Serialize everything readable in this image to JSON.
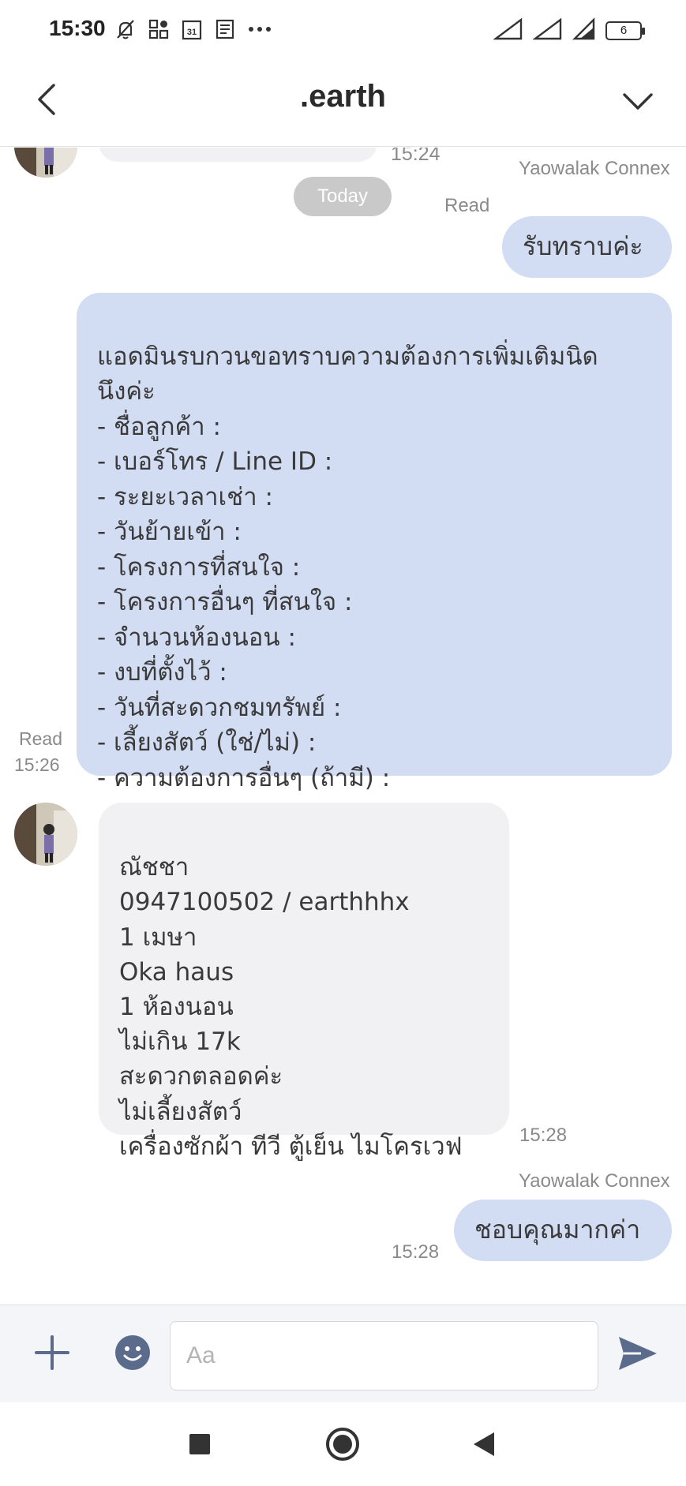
{
  "status_bar": {
    "time": "15:30",
    "icons": [
      "mute-bell-icon",
      "apps-icon",
      "calendar-31-icon",
      "news-icon",
      "more-dots-icon"
    ],
    "battery_level": "6"
  },
  "header": {
    "title": ".earth",
    "back_icon": "chevron-left-icon",
    "menu_icon": "chevron-down-icon"
  },
  "chat": {
    "top_partial_time": "15:24",
    "date_divider": "Today",
    "messages": [
      {
        "sender": "Yaowalak Connex",
        "text": "รับทราบค่ะ",
        "read_label": "Read"
      },
      {
        "text": "แอดมินรบกวนขอทราบความต้องการเพิ่มเติมนิด\nนึงค่ะ\n- ชื่อลูกค้า :\n- เบอร์โทร / Line ID :\n- ระยะเวลาเช่า :\n- วันย้ายเข้า :\n- โครงการที่สนใจ :\n- โครงการอื่นๆ ที่สนใจ :\n- จำนวนห้องนอน :\n- งบที่ตั้งไว้ :\n- วันที่สะดวกชมทรัพย์ :\n- เลี้ยงสัตว์ (ใช่/ไม่) :\n- ความต้องการอื่นๆ (ถ้ามี) :",
        "read_label": "Read",
        "time": "15:26"
      },
      {
        "text": "ณัชชา\n0947100502 / earthhhx\n1 เมษา\nOka haus\n1 ห้องนอน\nไม่เกิน 17k\nสะดวกตลอดค่ะ\nไม่เลี้ยงสัตว์\nเครื่องซักผ้า ทีวี ตู้เย็น ไมโครเวฟ",
        "time": "15:28"
      },
      {
        "sender": "Yaowalak Connex",
        "text": "ชอบคุณมากค่า",
        "time": "15:28"
      }
    ]
  },
  "input_bar": {
    "placeholder": "Aa",
    "plus_icon": "plus-icon",
    "emoji_icon": "emoji-icon",
    "send_icon": "send-icon"
  },
  "nav_bar": {
    "buttons": [
      "recent-apps-icon",
      "home-icon",
      "back-triangle-icon"
    ]
  },
  "colors": {
    "my_bubble": "#d2dcf2",
    "their_bubble": "#f1f1f3",
    "accent": "#5b6b8c"
  }
}
